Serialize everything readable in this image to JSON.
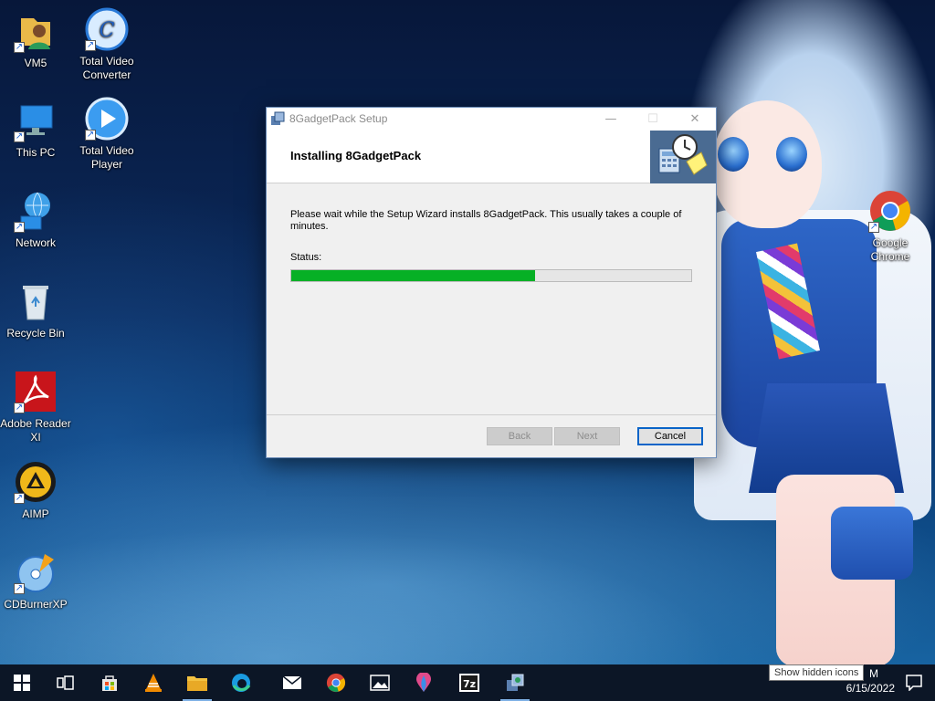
{
  "desktop": {
    "icons": [
      {
        "label": "VM5"
      },
      {
        "label": "Total Video Converter"
      },
      {
        "label": "This PC"
      },
      {
        "label": "Total Video Player"
      },
      {
        "label": "Network"
      },
      {
        "label": "Recycle Bin"
      },
      {
        "label": "Adobe Reader XI"
      },
      {
        "label": "AIMP"
      },
      {
        "label": "CDBurnerXP"
      },
      {
        "label": "Google Chrome"
      }
    ]
  },
  "installer": {
    "window_title": "8GadgetPack Setup",
    "heading": "Installing 8GadgetPack",
    "description": "Please wait while the Setup Wizard installs 8GadgetPack. This usually takes a couple of minutes.",
    "status_label": "Status:",
    "progress_percent": 61,
    "buttons": {
      "back": "Back",
      "next": "Next",
      "cancel": "Cancel"
    },
    "controls": {
      "minimize": "—",
      "maximize": "☐",
      "close": "✕"
    }
  },
  "tooltip": {
    "text": "Show hidden icons"
  },
  "taskbar": {
    "items": [
      "start-icon",
      "task-view-icon",
      "store-icon",
      "vlc-icon",
      "file-explorer-icon",
      "edge-icon",
      "mail-icon",
      "chrome-icon",
      "photos-icon",
      "maps-icon",
      "7zip-icon",
      "setup-icon"
    ],
    "clock_time": "M",
    "clock_date": "6/15/2022"
  },
  "colors": {
    "progress": "#06b025",
    "accent": "#0a64c8",
    "taskbar": "#0c1626"
  }
}
